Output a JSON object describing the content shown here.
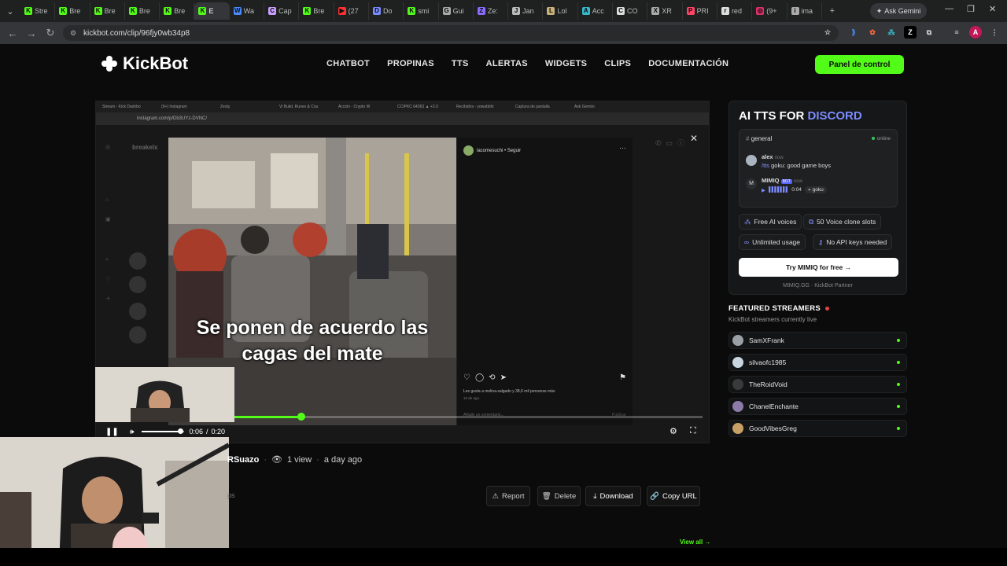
{
  "browser": {
    "tabs": [
      {
        "label": "Stre",
        "fav": "K",
        "color": "#53fc18"
      },
      {
        "label": "Bre",
        "fav": "K",
        "color": "#53fc18"
      },
      {
        "label": "Bre",
        "fav": "K",
        "color": "#53fc18"
      },
      {
        "label": "Bre",
        "fav": "K",
        "color": "#53fc18"
      },
      {
        "label": "Bre",
        "fav": "K",
        "color": "#53fc18"
      },
      {
        "label": "E",
        "fav": "K",
        "color": "#53fc18",
        "active": true
      },
      {
        "label": "Wa",
        "fav": "W",
        "color": "#4a8cff"
      },
      {
        "label": "Cap",
        "fav": "C",
        "color": "#c9a0ff"
      },
      {
        "label": "Bre",
        "fav": "K",
        "color": "#53fc18"
      },
      {
        "label": "(27",
        "fav": "▶",
        "color": "#ff3030"
      },
      {
        "label": "Do",
        "fav": "D",
        "color": "#7b8cff"
      },
      {
        "label": "smi",
        "fav": "K",
        "color": "#53fc18"
      },
      {
        "label": "Gui",
        "fav": "G",
        "color": "#aaaaaa"
      },
      {
        "label": "Ze:",
        "fav": "Z",
        "color": "#8a6bff"
      },
      {
        "label": "Jan",
        "fav": "J",
        "color": "#bbbbbb"
      },
      {
        "label": "Lol",
        "fav": "L",
        "color": "#c8b27a"
      },
      {
        "label": "Acc",
        "fav": "A",
        "color": "#36b8c9"
      },
      {
        "label": "CO",
        "fav": "C",
        "color": "#dddddd"
      },
      {
        "label": "XR",
        "fav": "X",
        "color": "#aaaaaa"
      },
      {
        "label": "PRI",
        "fav": "P",
        "color": "#ff4466"
      },
      {
        "label": "red",
        "fav": "r",
        "color": "#dddddd"
      },
      {
        "label": "(9+",
        "fav": "◎",
        "color": "#e1306c"
      },
      {
        "label": "ima",
        "fav": "i",
        "color": "#aaaaaa"
      }
    ],
    "new_tab": "+",
    "gemini_label": "Ask Gemini",
    "url": "kickbot.com/clip/96fjy0wb34p8"
  },
  "site": {
    "logo": "KickBot",
    "nav": [
      "CHATBOT",
      "PROPINAS",
      "TTS",
      "ALERTAS",
      "WIDGETS",
      "CLIPS",
      "DOCUMENTACIÓN"
    ],
    "panel_button": "Panel de control"
  },
  "video": {
    "inner_url": "instagram.com/p/Db3UYz-DVNC/",
    "inner_tabs": [
      "Stream - Kick Dashbo",
      "(9+) Instagram",
      "Zesty",
      "Vi Build, Runes & Cou",
      "Acción - Crypto W",
      "CCIPKC 64363 ▲ +2.0",
      "Recibidos - yowabbhi",
      "Captura de pantalla",
      "Ask Gemini"
    ],
    "ig_account": "breakelx",
    "ig_post_user": "lacomesuchi • Seguir",
    "ig_likes": "Les gusta a molina.salgado  y 38,6 mil personas más",
    "ig_date": "10 de ago.",
    "ig_comment_placeholder": "Añade un comentario...",
    "ig_publish": "Publicar",
    "caption": "Se ponen de acuerdo las cagas del mate",
    "time_current": "0:06",
    "time_total": "0:20",
    "progress_fraction": 0.33,
    "volume_fraction": 0.9
  },
  "meta": {
    "author": "RSuazo",
    "views": "1 view",
    "age": "a day ago",
    "tag_fragment": "ps"
  },
  "actions": {
    "report": "Report",
    "delete": "Delete",
    "download": "Download",
    "copy_url": "Copy URL"
  },
  "view_all": "View all →",
  "tts_card": {
    "title_a": "AI TTS FOR",
    "title_b": "DISCORD",
    "channel": "general",
    "status": "online",
    "msg1_user": "alex",
    "msg1_time": "now",
    "msg1_cmd": "/tts",
    "msg1_text": "goku: good game boys",
    "msg2_user": "MIMIQ",
    "msg2_badge": "BOT",
    "msg2_time": "now",
    "msg2_duration": "0:04",
    "msg2_voice": "goku",
    "features": [
      "Free AI voices",
      "50 Voice clone slots",
      "Unlimited usage",
      "No API keys needed"
    ],
    "cta": "Try MIMIQ for free →",
    "partner": "MIMIQ.GG · KickBot Partner"
  },
  "featured": {
    "heading": "FEATURED STREAMERS",
    "subheading": "KickBot streamers currently live",
    "streamers": [
      {
        "name": "SamXFrank",
        "color": "#9aa0a6"
      },
      {
        "name": "silvaofc1985",
        "color": "#c9d6e0"
      },
      {
        "name": "TheRoidVoid",
        "color": "#3a3a3a"
      },
      {
        "name": "ChanelEnchante",
        "color": "#8c7aa8"
      },
      {
        "name": "GoodVibesGreg",
        "color": "#c8a066"
      }
    ]
  },
  "colors": {
    "accent": "#53fc18",
    "discord": "#7c8cff",
    "live": "#e04444"
  }
}
